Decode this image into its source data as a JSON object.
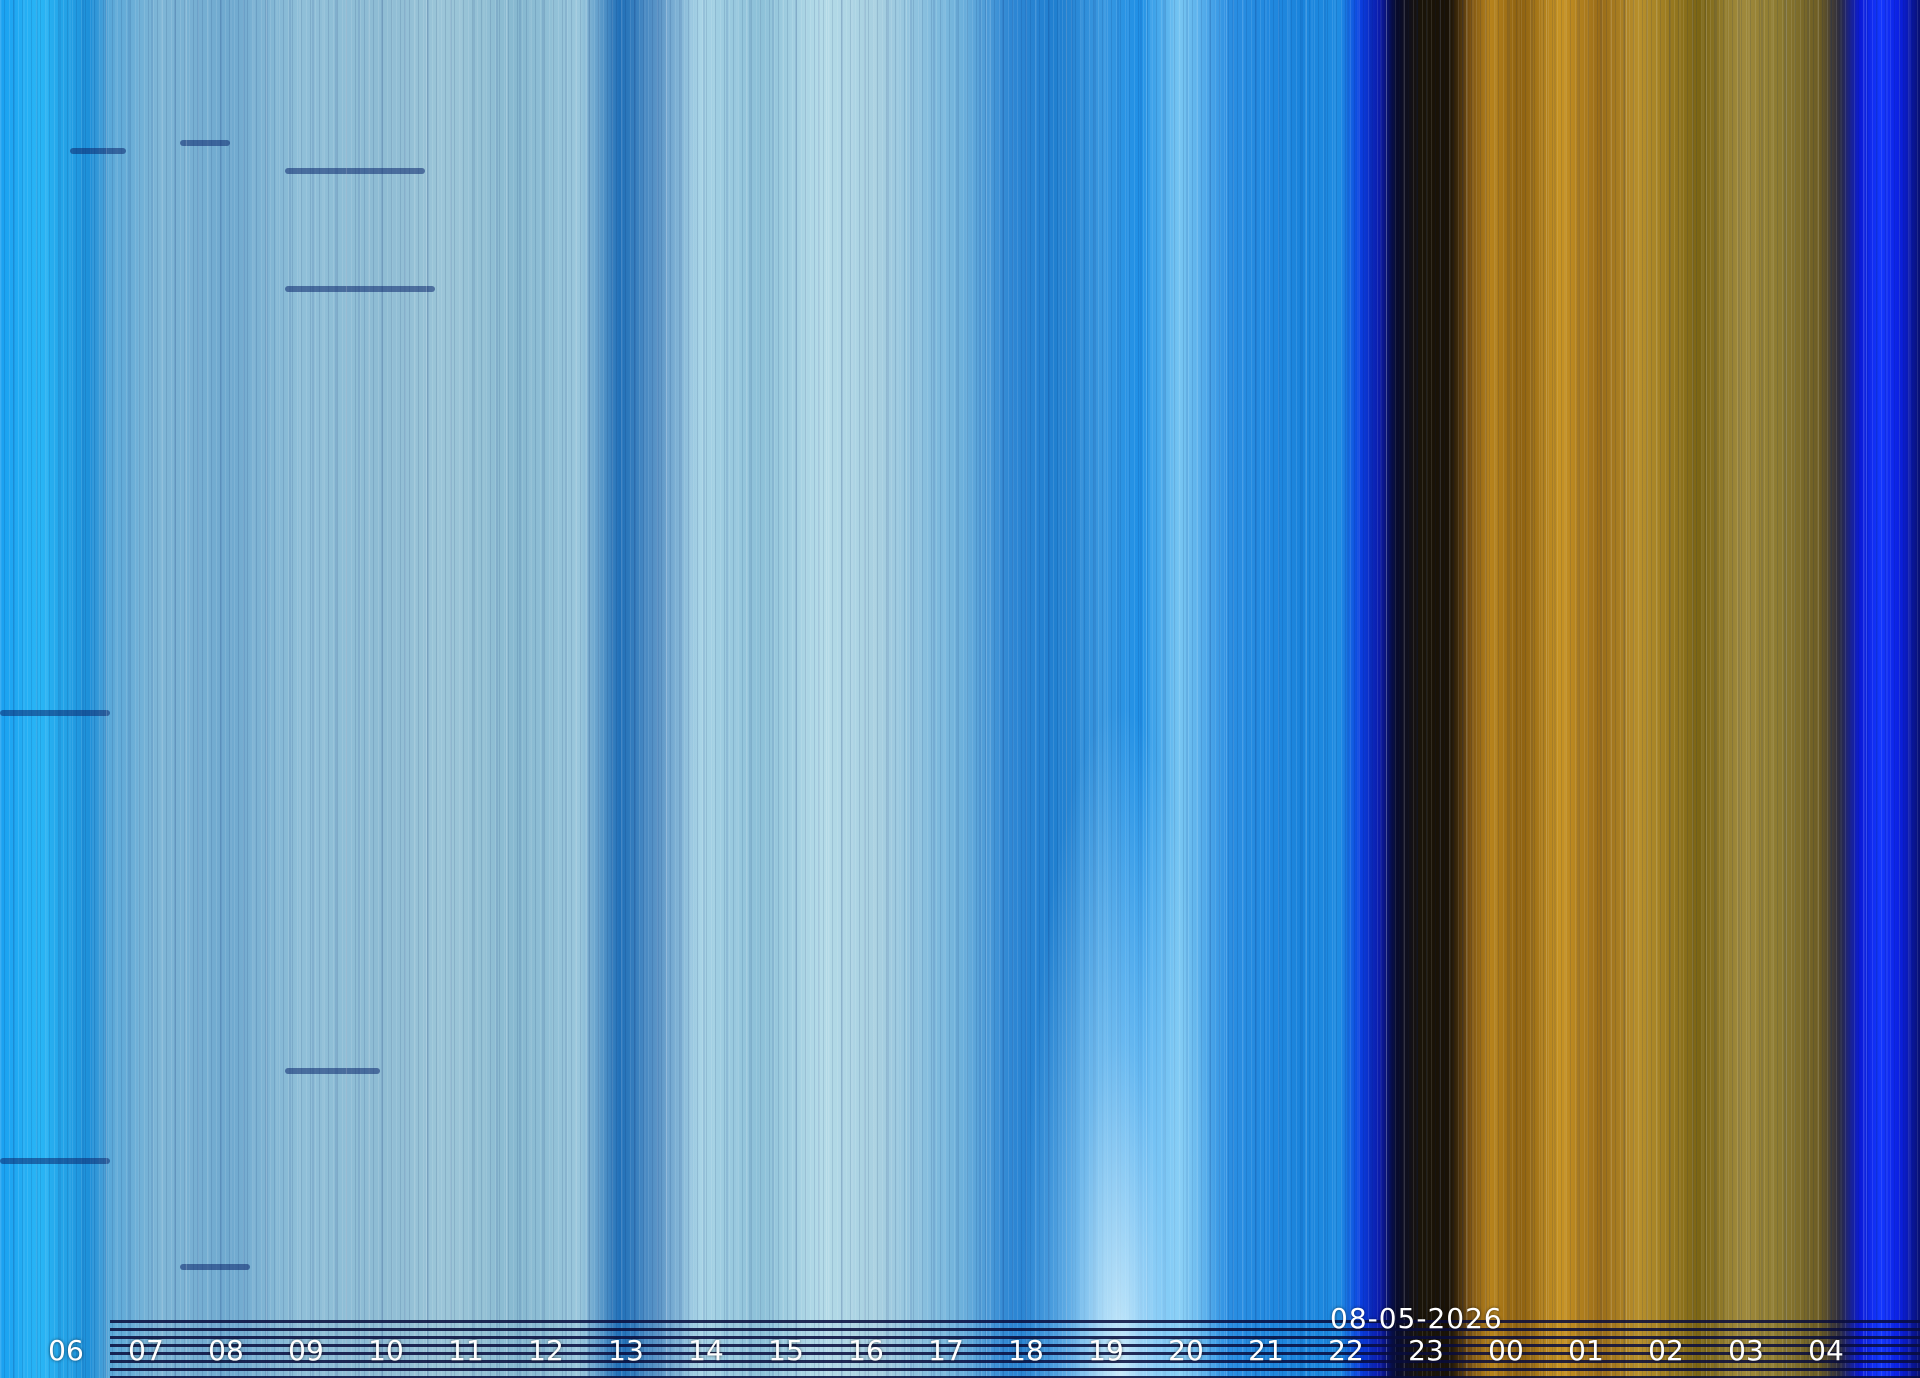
{
  "date_label": "08-05-2026",
  "hour_labels": [
    "06",
    "07",
    "08",
    "09",
    "10",
    "11",
    "12",
    "13",
    "14",
    "15",
    "16",
    "17",
    "18",
    "19",
    "20",
    "21",
    "22",
    "23",
    "00",
    "01",
    "02",
    "03",
    "04"
  ],
  "colors": {
    "day_sky": "#29b6f6",
    "dusk_blue": "#0b1fe0",
    "night_amber": "#b8841c",
    "label_text": "#ffffff"
  }
}
